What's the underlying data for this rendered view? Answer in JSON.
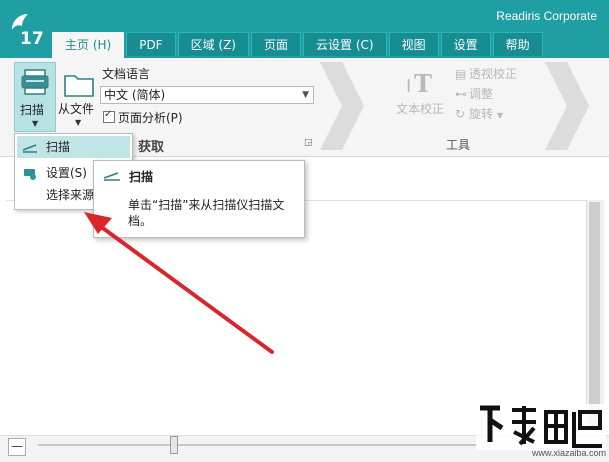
{
  "window": {
    "title": "Readiris Corporate",
    "logo_text": "17"
  },
  "tabs": [
    {
      "label": "主页 (H)",
      "active": true
    },
    {
      "label": "PDF"
    },
    {
      "label": "区域 (Z)"
    },
    {
      "label": "页面"
    },
    {
      "label": "云设置 (C)"
    },
    {
      "label": "视图"
    },
    {
      "label": "设置"
    },
    {
      "label": "帮助"
    }
  ],
  "ribbon": {
    "scan_label": "扫描",
    "from_file_label": "从文件",
    "doc_lang_label": "文档语言",
    "doc_lang_value": "中文 (简体)",
    "page_analysis_label": "页面分析(P)",
    "page_analysis_checked": true,
    "group_acquire": "获取",
    "text_correct_label": "文本校正",
    "perspective_label": "透视校正",
    "adjust_label": "调整",
    "rotate_label": "旋转",
    "group_tools": "工具"
  },
  "scan_menu": {
    "items": [
      {
        "label": "扫描",
        "highlighted": true
      },
      {
        "label": "设置(S)"
      },
      {
        "label": "选择来源"
      }
    ]
  },
  "tooltip": {
    "title": "扫描",
    "body": "单击“扫描”来从扫描仪扫描文档。"
  },
  "watermark": {
    "url": "www.xiazaiba.com"
  },
  "colors": {
    "accent": "#1f9fa3",
    "highlight": "#bfe5e6",
    "arrow": "#d9262b"
  }
}
